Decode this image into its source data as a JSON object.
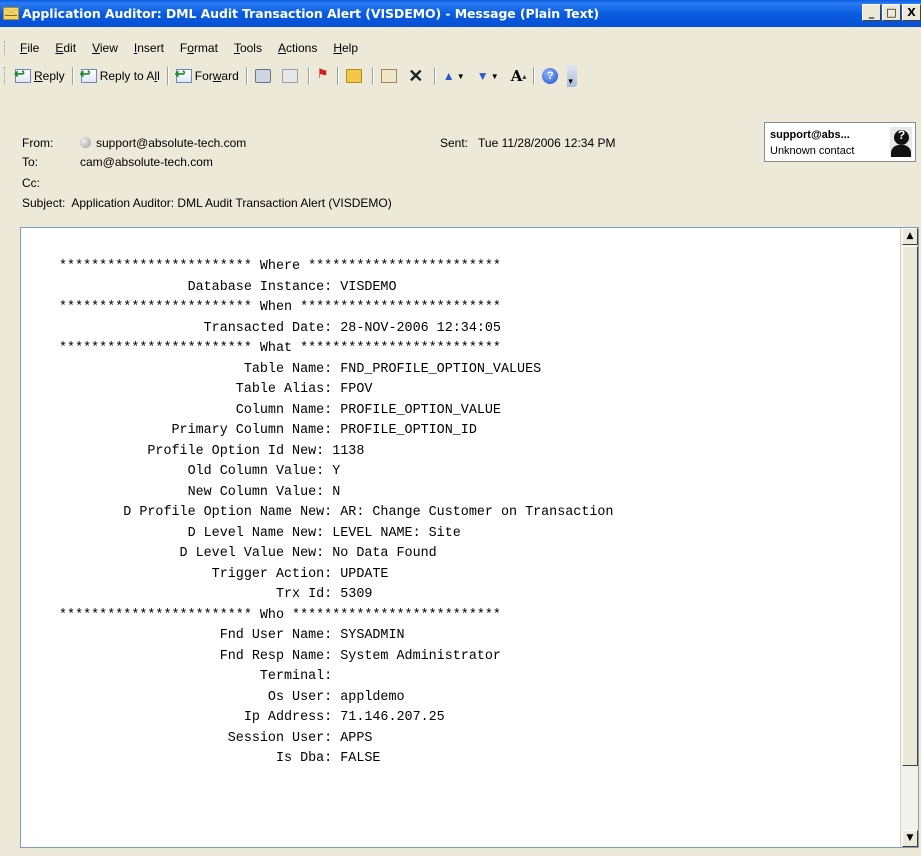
{
  "window": {
    "title": "Application Auditor: DML Audit Transaction Alert (VISDEMO) - Message (Plain Text)",
    "controls": {
      "minimize": "_",
      "maximize": "□",
      "close": "X"
    }
  },
  "menu": [
    {
      "label": "File",
      "accel": "F",
      "rest": "ile"
    },
    {
      "label": "Edit",
      "accel": "E",
      "rest": "dit"
    },
    {
      "label": "View",
      "accel": "V",
      "rest": "iew"
    },
    {
      "label": "Insert",
      "accel": "I",
      "rest": "nsert"
    },
    {
      "label": "Format",
      "pre": "F",
      "accel": "o",
      "rest": "rmat"
    },
    {
      "label": "Tools",
      "accel": "T",
      "rest": "ools"
    },
    {
      "label": "Actions",
      "accel": "A",
      "rest": "ctions"
    },
    {
      "label": "Help",
      "accel": "H",
      "rest": "elp"
    }
  ],
  "toolbar": {
    "reply": {
      "accel": "R",
      "rest": "eply"
    },
    "reply_all": {
      "pre": "Reply to A",
      "accel": "l",
      "rest": "l"
    },
    "forward": {
      "pre": "For",
      "accel": "w",
      "rest": "ard"
    },
    "font_size_label": "A"
  },
  "header": {
    "from_label": "From:",
    "from": "support@absolute-tech.com",
    "sent_label": "Sent:",
    "sent": "Tue 11/28/2006 12:34 PM",
    "to_label": "To:",
    "to": "cam@absolute-tech.com",
    "cc_label": "Cc:",
    "cc": "",
    "subject_label": "Subject:",
    "subject": "Application Auditor: DML Audit Transaction Alert (VISDEMO)",
    "contact_card": {
      "name": "support@abs...",
      "status": "Unknown contact"
    }
  },
  "body_lines": [
    "************************ Where ************************",
    "                Database Instance: VISDEMO",
    "************************ When *************************",
    "                  Transacted Date: 28-NOV-2006 12:34:05",
    "************************ What *************************",
    "                       Table Name: FND_PROFILE_OPTION_VALUES",
    "                      Table Alias: FPOV",
    "                      Column Name: PROFILE_OPTION_VALUE",
    "              Primary Column Name: PROFILE_OPTION_ID",
    "           Profile Option Id New: 1138",
    "                Old Column Value: Y",
    "                New Column Value: N",
    "        D Profile Option Name New: AR: Change Customer on Transaction",
    "                D Level Name New: LEVEL NAME: Site",
    "               D Level Value New: No Data Found",
    "                   Trigger Action: UPDATE",
    "                           Trx Id: 5309",
    "************************ Who **************************",
    "                    Fnd User Name: SYSADMIN",
    "                    Fnd Resp Name: System Administrator",
    "                         Terminal:",
    "                          Os User: appldemo",
    "                       Ip Address: 71.146.207.25",
    "                     Session User: APPS",
    "                           Is Dba: FALSE"
  ]
}
